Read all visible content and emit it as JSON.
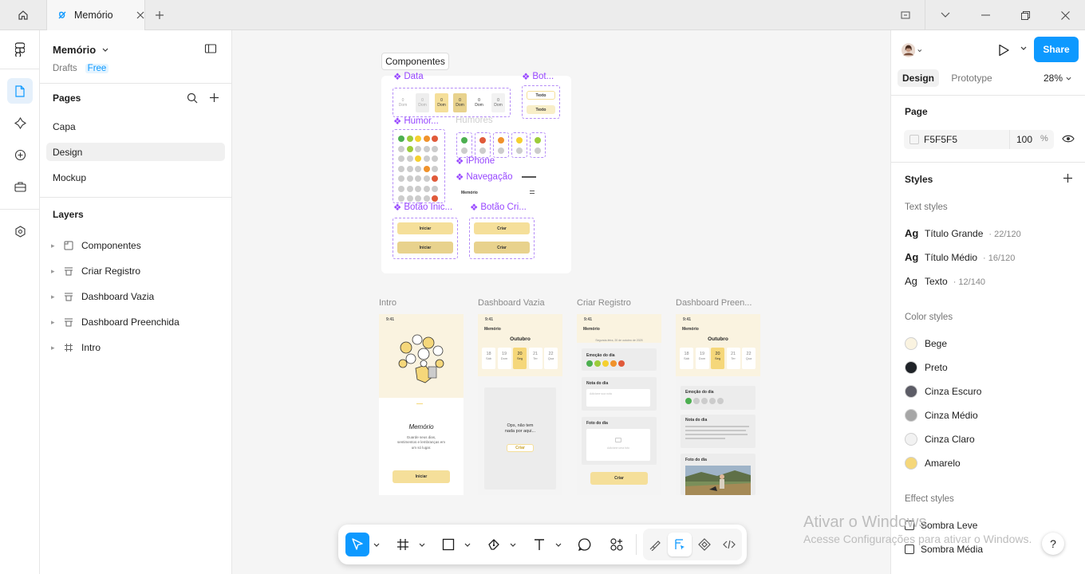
{
  "tab": {
    "title": "Memório"
  },
  "file": {
    "name": "Memório",
    "location": "Drafts",
    "plan": "Free"
  },
  "pages": {
    "title": "Pages",
    "items": [
      "Capa",
      "Design",
      "Mockup"
    ],
    "selected": "Design"
  },
  "layers": {
    "title": "Layers",
    "items": [
      {
        "name": "Componentes",
        "icon": "section-icon"
      },
      {
        "name": "Criar Registro",
        "icon": "frame-stack-icon"
      },
      {
        "name": "Dashboard Vazia",
        "icon": "frame-stack-icon"
      },
      {
        "name": "Dashboard Preenchida",
        "icon": "frame-stack-icon"
      },
      {
        "name": "Intro",
        "icon": "frame-icon"
      }
    ]
  },
  "canvas": {
    "section_label": "Componentes",
    "components": {
      "data": "Data",
      "bot": "Bot...",
      "humor": "Humor...",
      "humores": "Humores",
      "iphone": "iPhone",
      "navegacao": "Navegação",
      "botao_inic": "Botão Inic...",
      "botao_cri": "Botão Cri...",
      "day_label": "Dom",
      "day_value": "0",
      "texto_btn": "Texto",
      "iniciar_btn": "Iniciar",
      "criar_btn": "Criar",
      "nav_title": "Memório"
    },
    "frames": {
      "intro": "Intro",
      "dashboard_vazia": "Dashboard Vazia",
      "criar_registro": "Criar Registro",
      "dashboard_preen": "Dashboard Preen..."
    },
    "phone_content": {
      "time": "9:41",
      "app_name": "Memório",
      "month": "Outubro",
      "days": [
        {
          "n": "18",
          "d": "Sáb"
        },
        {
          "n": "19",
          "d": "Dom"
        },
        {
          "n": "20",
          "d": "Seg"
        },
        {
          "n": "21",
          "d": "Ter"
        },
        {
          "n": "22",
          "d": "Qua"
        }
      ],
      "intro_title": "Memório",
      "intro_text": "Guarde seus dias, sentimentos e lembranças em um só lugar.",
      "intro_button": "Iniciar",
      "empty_text": "Ops, não tem nada por aqui...",
      "empty_button": "Criar",
      "criar_date": "Segunda-feira, 20 de outubro de 2025",
      "emocao": "Emoção do dia",
      "nota": "Nota do dia",
      "nota_placeholder": "Adicione sua nota",
      "foto": "Foto do dia",
      "foto_placeholder": "Adicione uma foto",
      "criar_button": "Criar"
    }
  },
  "right": {
    "share": "Share",
    "tabs": [
      "Design",
      "Prototype"
    ],
    "active_tab": "Design",
    "zoom": "28%",
    "page": {
      "title": "Page",
      "color": "F5F5F5",
      "opacity": "100",
      "unit": "%"
    },
    "styles_title": "Styles",
    "text_styles_title": "Text styles",
    "text_styles": [
      {
        "ag": "Ag",
        "name": "Título Grande",
        "meta": "· 22/120"
      },
      {
        "ag": "Ag",
        "name": "Título Médio",
        "meta": "· 16/120"
      },
      {
        "ag": "Ag",
        "name": "Texto",
        "meta": "· 12/140"
      }
    ],
    "color_styles_title": "Color styles",
    "color_styles": [
      {
        "name": "Bege",
        "hex": "#FAF3E0"
      },
      {
        "name": "Preto",
        "hex": "#1F2328"
      },
      {
        "name": "Cinza Escuro",
        "hex": "#5C5C66"
      },
      {
        "name": "Cinza Médio",
        "hex": "#A6A6A6"
      },
      {
        "name": "Cinza Claro",
        "hex": "#F2F2F2"
      },
      {
        "name": "Amarelo",
        "hex": "#F5D77A"
      }
    ],
    "effect_styles_title": "Effect styles",
    "effect_styles": [
      "Sombra Leve",
      "Sombra Média"
    ]
  },
  "watermark": {
    "line1": "Ativar o Windows",
    "line2": "Acesse Configurações para ativar o Windows."
  },
  "help": "?",
  "colors": {
    "accent": "#0D99FF",
    "component": "#9747FF",
    "yellow": "#F5DF9A"
  }
}
